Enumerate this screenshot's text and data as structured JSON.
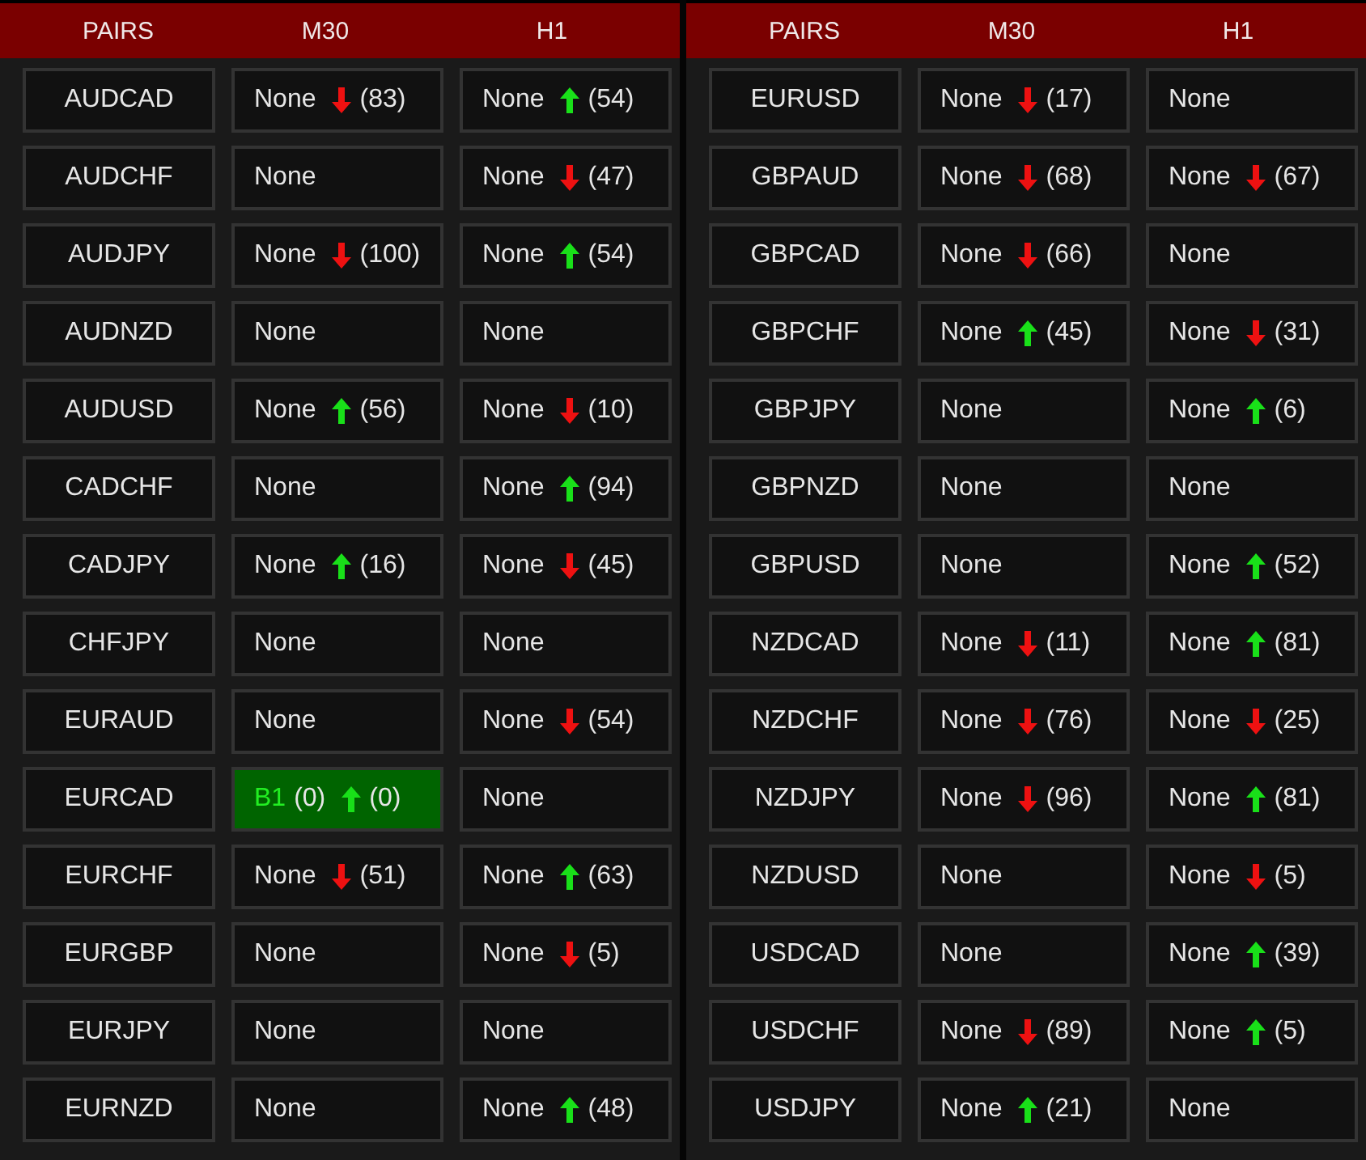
{
  "panels": [
    {
      "headers": [
        "PAIRS",
        "M30",
        "H1"
      ],
      "rows": [
        {
          "pair": "AUDCAD",
          "cells": [
            {
              "signal": "None",
              "active": false,
              "kind": "down",
              "count": "(83)"
            },
            {
              "signal": "None",
              "active": false,
              "kind": "up",
              "count": "(54)"
            }
          ]
        },
        {
          "pair": "AUDCHF",
          "cells": [
            {
              "signal": "None",
              "active": false,
              "kind": "plain"
            },
            {
              "signal": "None",
              "active": false,
              "kind": "down",
              "count": "(47)"
            }
          ]
        },
        {
          "pair": "AUDJPY",
          "cells": [
            {
              "signal": "None",
              "active": false,
              "kind": "down",
              "count": "(100)"
            },
            {
              "signal": "None",
              "active": false,
              "kind": "up",
              "count": "(54)"
            }
          ]
        },
        {
          "pair": "AUDNZD",
          "cells": [
            {
              "signal": "None",
              "active": false,
              "kind": "plain"
            },
            {
              "signal": "None",
              "active": false,
              "kind": "plain"
            }
          ]
        },
        {
          "pair": "AUDUSD",
          "cells": [
            {
              "signal": "None",
              "active": false,
              "kind": "up",
              "count": "(56)"
            },
            {
              "signal": "None",
              "active": false,
              "kind": "down",
              "count": "(10)"
            }
          ]
        },
        {
          "pair": "CADCHF",
          "cells": [
            {
              "signal": "None",
              "active": false,
              "kind": "plain"
            },
            {
              "signal": "None",
              "active": false,
              "kind": "up",
              "count": "(94)"
            }
          ]
        },
        {
          "pair": "CADJPY",
          "cells": [
            {
              "signal": "None",
              "active": false,
              "kind": "up",
              "count": "(16)"
            },
            {
              "signal": "None",
              "active": false,
              "kind": "down",
              "count": "(45)"
            }
          ]
        },
        {
          "pair": "CHFJPY",
          "cells": [
            {
              "signal": "None",
              "active": false,
              "kind": "plain"
            },
            {
              "signal": "None",
              "active": false,
              "kind": "plain"
            }
          ]
        },
        {
          "pair": "EURAUD",
          "cells": [
            {
              "signal": "None",
              "active": false,
              "kind": "plain"
            },
            {
              "signal": "None",
              "active": false,
              "kind": "down",
              "count": "(54)"
            }
          ]
        },
        {
          "pair": "EURCAD",
          "cells": [
            {
              "signal": "B1",
              "signal_count": "(0)",
              "active": true,
              "kind": "up",
              "count": "(0)"
            },
            {
              "signal": "None",
              "active": false,
              "kind": "plain"
            }
          ]
        },
        {
          "pair": "EURCHF",
          "cells": [
            {
              "signal": "None",
              "active": false,
              "kind": "down",
              "count": "(51)"
            },
            {
              "signal": "None",
              "active": false,
              "kind": "up",
              "count": "(63)"
            }
          ]
        },
        {
          "pair": "EURGBP",
          "cells": [
            {
              "signal": "None",
              "active": false,
              "kind": "plain"
            },
            {
              "signal": "None",
              "active": false,
              "kind": "down",
              "count": "(5)"
            }
          ]
        },
        {
          "pair": "EURJPY",
          "cells": [
            {
              "signal": "None",
              "active": false,
              "kind": "plain"
            },
            {
              "signal": "None",
              "active": false,
              "kind": "plain"
            }
          ]
        },
        {
          "pair": "EURNZD",
          "cells": [
            {
              "signal": "None",
              "active": false,
              "kind": "plain"
            },
            {
              "signal": "None",
              "active": false,
              "kind": "up",
              "count": "(48)"
            }
          ]
        }
      ]
    },
    {
      "headers": [
        "PAIRS",
        "M30",
        "H1"
      ],
      "rows": [
        {
          "pair": "EURUSD",
          "cells": [
            {
              "signal": "None",
              "active": false,
              "kind": "down",
              "count": "(17)"
            },
            {
              "signal": "None",
              "active": false,
              "kind": "plain"
            }
          ]
        },
        {
          "pair": "GBPAUD",
          "cells": [
            {
              "signal": "None",
              "active": false,
              "kind": "down",
              "count": "(68)"
            },
            {
              "signal": "None",
              "active": false,
              "kind": "down",
              "count": "(67)"
            }
          ]
        },
        {
          "pair": "GBPCAD",
          "cells": [
            {
              "signal": "None",
              "active": false,
              "kind": "down",
              "count": "(66)"
            },
            {
              "signal": "None",
              "active": false,
              "kind": "plain"
            }
          ]
        },
        {
          "pair": "GBPCHF",
          "cells": [
            {
              "signal": "None",
              "active": false,
              "kind": "up",
              "count": "(45)"
            },
            {
              "signal": "None",
              "active": false,
              "kind": "down",
              "count": "(31)"
            }
          ]
        },
        {
          "pair": "GBPJPY",
          "cells": [
            {
              "signal": "None",
              "active": false,
              "kind": "plain"
            },
            {
              "signal": "None",
              "active": false,
              "kind": "up",
              "count": "(6)"
            }
          ]
        },
        {
          "pair": "GBPNZD",
          "cells": [
            {
              "signal": "None",
              "active": false,
              "kind": "plain"
            },
            {
              "signal": "None",
              "active": false,
              "kind": "plain"
            }
          ]
        },
        {
          "pair": "GBPUSD",
          "cells": [
            {
              "signal": "None",
              "active": false,
              "kind": "plain"
            },
            {
              "signal": "None",
              "active": false,
              "kind": "up",
              "count": "(52)"
            }
          ]
        },
        {
          "pair": "NZDCAD",
          "cells": [
            {
              "signal": "None",
              "active": false,
              "kind": "down",
              "count": "(11)"
            },
            {
              "signal": "None",
              "active": false,
              "kind": "up",
              "count": "(81)"
            }
          ]
        },
        {
          "pair": "NZDCHF",
          "cells": [
            {
              "signal": "None",
              "active": false,
              "kind": "down",
              "count": "(76)"
            },
            {
              "signal": "None",
              "active": false,
              "kind": "down",
              "count": "(25)"
            }
          ]
        },
        {
          "pair": "NZDJPY",
          "cells": [
            {
              "signal": "None",
              "active": false,
              "kind": "down",
              "count": "(96)"
            },
            {
              "signal": "None",
              "active": false,
              "kind": "up",
              "count": "(81)"
            }
          ]
        },
        {
          "pair": "NZDUSD",
          "cells": [
            {
              "signal": "None",
              "active": false,
              "kind": "plain"
            },
            {
              "signal": "None",
              "active": false,
              "kind": "down",
              "count": "(5)"
            }
          ]
        },
        {
          "pair": "USDCAD",
          "cells": [
            {
              "signal": "None",
              "active": false,
              "kind": "plain"
            },
            {
              "signal": "None",
              "active": false,
              "kind": "up",
              "count": "(39)"
            }
          ]
        },
        {
          "pair": "USDCHF",
          "cells": [
            {
              "signal": "None",
              "active": false,
              "kind": "down",
              "count": "(89)"
            },
            {
              "signal": "None",
              "active": false,
              "kind": "up",
              "count": "(5)"
            }
          ]
        },
        {
          "pair": "USDJPY",
          "cells": [
            {
              "signal": "None",
              "active": false,
              "kind": "up",
              "count": "(21)"
            },
            {
              "signal": "None",
              "active": false,
              "kind": "plain"
            }
          ]
        }
      ]
    }
  ]
}
